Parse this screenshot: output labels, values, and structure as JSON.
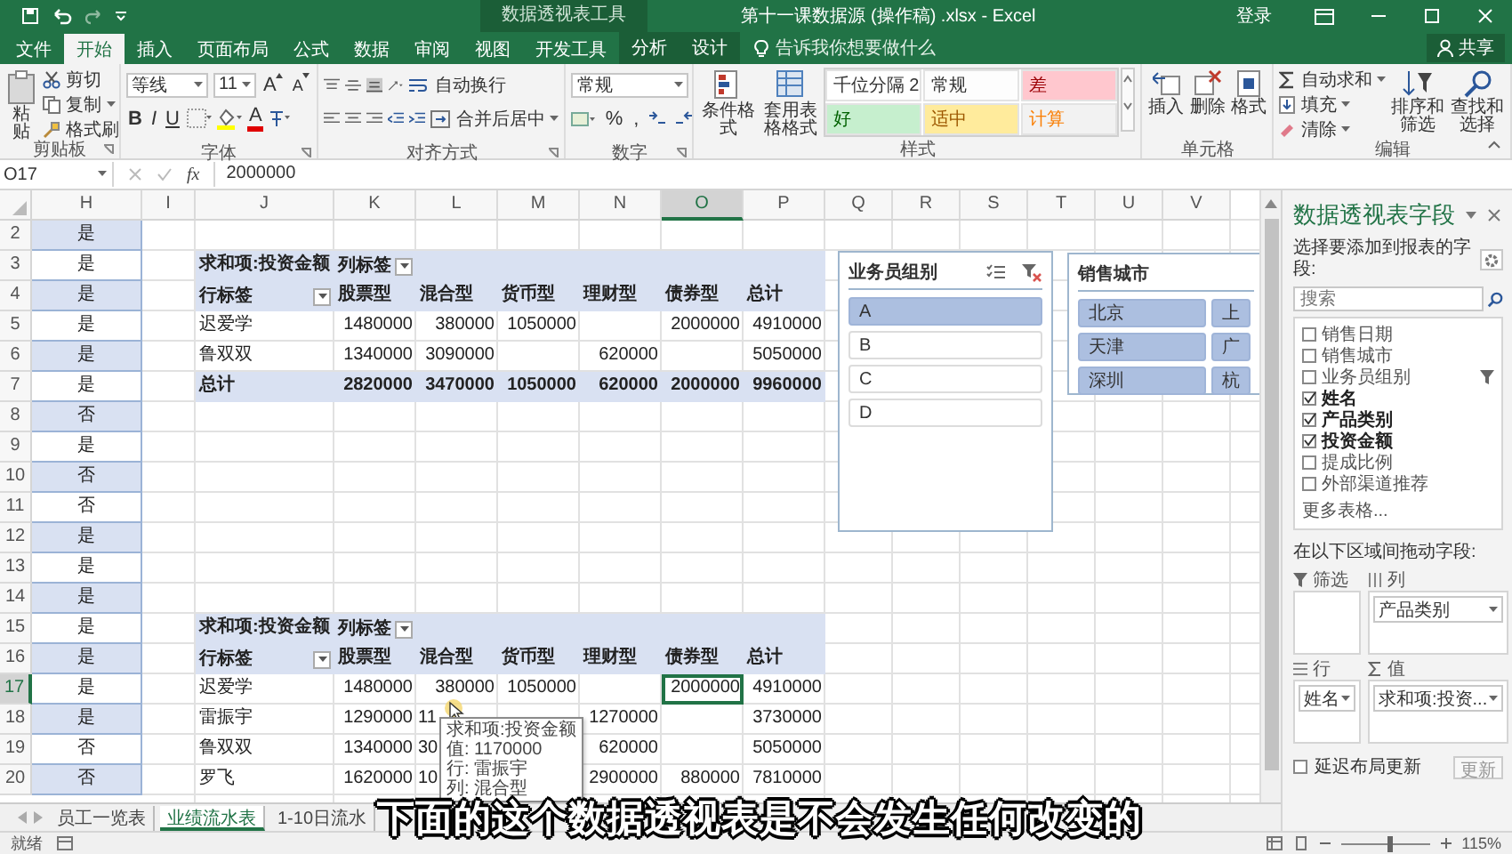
{
  "title_bar": {
    "context_label": "数据透视表工具",
    "title": "第十一课数据源 (操作稿) .xlsx - Excel",
    "sign_in": "登录"
  },
  "tabs": [
    {
      "label": "文件",
      "selected": false,
      "kind": "normal"
    },
    {
      "label": "开始",
      "selected": true,
      "kind": "normal"
    },
    {
      "label": "插入",
      "selected": false,
      "kind": "normal"
    },
    {
      "label": "页面布局",
      "selected": false,
      "kind": "normal"
    },
    {
      "label": "公式",
      "selected": false,
      "kind": "normal"
    },
    {
      "label": "数据",
      "selected": false,
      "kind": "normal"
    },
    {
      "label": "审阅",
      "selected": false,
      "kind": "normal"
    },
    {
      "label": "视图",
      "selected": false,
      "kind": "normal"
    },
    {
      "label": "开发工具",
      "selected": false,
      "kind": "normal"
    },
    {
      "label": "分析",
      "selected": false,
      "kind": "contextual"
    },
    {
      "label": "设计",
      "selected": false,
      "kind": "contextual"
    }
  ],
  "tell_me": "告诉我你想要做什么",
  "share": "共享",
  "ribbon": {
    "clipboard": {
      "paste": "粘贴",
      "cut": "剪切",
      "copy": "复制",
      "painter": "格式刷",
      "label": "剪贴板"
    },
    "font": {
      "name": "等线",
      "size": "11",
      "grow": "A",
      "shrink": "A",
      "bold": "B",
      "italic": "I",
      "underline": "U",
      "font_color": "A",
      "label": "字体"
    },
    "alignment": {
      "wrap": "自动换行",
      "merge": "合并后居中",
      "label": "对齐方式"
    },
    "number": {
      "format": "常规",
      "percent": "%",
      "comma": ",",
      "label": "数字"
    },
    "styles": {
      "conditional": "条件格式",
      "table": "套用表格格式",
      "cells": [
        {
          "label": "千位分隔 2",
          "color": "#ffffff"
        },
        {
          "label": "常规",
          "color": "#fdfdfd"
        },
        {
          "label": "差",
          "color": "#ffc7ce"
        },
        {
          "label": "好",
          "color": "#c6efce"
        },
        {
          "label": "适中",
          "color": "#ffeb9c"
        },
        {
          "label": "计算",
          "color": "#f2f2f2"
        }
      ],
      "label": "样式"
    },
    "cells": {
      "insert": "插入",
      "delete": "删除",
      "format": "格式",
      "label": "单元格"
    },
    "editing": {
      "autosum": "自动求和",
      "fill": "填充",
      "clear": "清除",
      "sort": "排序和筛选",
      "find": "查找和选择",
      "label": "编辑"
    }
  },
  "formula_bar": {
    "name_box": "O17",
    "fx": "fx",
    "value": "2000000"
  },
  "sheet": {
    "columns": [
      {
        "label": "H",
        "selected": false
      },
      {
        "label": "I",
        "selected": false
      },
      {
        "label": "J",
        "selected": false
      },
      {
        "label": "K",
        "selected": false
      },
      {
        "label": "L",
        "selected": false
      },
      {
        "label": "M",
        "selected": false
      },
      {
        "label": "N",
        "selected": false
      },
      {
        "label": "O",
        "selected": true
      },
      {
        "label": "P",
        "selected": false
      },
      {
        "label": "Q",
        "selected": false
      },
      {
        "label": "R",
        "selected": false
      },
      {
        "label": "S",
        "selected": false
      },
      {
        "label": "T",
        "selected": false
      },
      {
        "label": "U",
        "selected": false
      },
      {
        "label": "V",
        "selected": false
      }
    ],
    "rows": [
      {
        "num": "2",
        "selected": false,
        "h": "是",
        "kind": "blank"
      },
      {
        "num": "3",
        "selected": false,
        "h": "是",
        "kind": "pivot_title",
        "cells": [
          "",
          "求和项:投资金额",
          "列标签",
          "",
          "",
          "",
          "",
          ""
        ]
      },
      {
        "num": "4",
        "selected": false,
        "h": "是",
        "kind": "pivot_cols",
        "cells": [
          "",
          "行标签",
          "股票型",
          "混合型",
          "货币型",
          "理财型",
          "债券型",
          "总计"
        ]
      },
      {
        "num": "5",
        "selected": false,
        "h": "是",
        "kind": "data",
        "cells": [
          "",
          "迟爱学",
          "1480000",
          "380000",
          "1050000",
          "",
          "2000000",
          "4910000"
        ]
      },
      {
        "num": "6",
        "selected": false,
        "h": "是",
        "kind": "data",
        "cells": [
          "",
          "鲁双双",
          "1340000",
          "3090000",
          "",
          "620000",
          "",
          "5050000"
        ]
      },
      {
        "num": "7",
        "selected": false,
        "h": "是",
        "kind": "total",
        "cells": [
          "",
          "总计",
          "2820000",
          "3470000",
          "1050000",
          "620000",
          "2000000",
          "9960000"
        ]
      },
      {
        "num": "8",
        "selected": false,
        "h": "否",
        "kind": "blank"
      },
      {
        "num": "9",
        "selected": false,
        "h": "是",
        "kind": "blank"
      },
      {
        "num": "10",
        "selected": false,
        "h": "否",
        "kind": "blank"
      },
      {
        "num": "11",
        "selected": false,
        "h": "否",
        "kind": "blank"
      },
      {
        "num": "12",
        "selected": false,
        "h": "是",
        "kind": "blank"
      },
      {
        "num": "13",
        "selected": false,
        "h": "是",
        "kind": "blank"
      },
      {
        "num": "14",
        "selected": false,
        "h": "是",
        "kind": "blank"
      },
      {
        "num": "15",
        "selected": false,
        "h": "是",
        "kind": "pivot_title",
        "cells": [
          "",
          "求和项:投资金额",
          "列标签",
          "",
          "",
          "",
          "",
          ""
        ]
      },
      {
        "num": "16",
        "selected": false,
        "h": "是",
        "kind": "pivot_cols",
        "cells": [
          "",
          "行标签",
          "股票型",
          "混合型",
          "货币型",
          "理财型",
          "债券型",
          "总计"
        ]
      },
      {
        "num": "17",
        "selected": true,
        "h": "是",
        "kind": "data",
        "cells": [
          "",
          "迟爱学",
          "1480000",
          "380000",
          "1050000",
          "",
          {
            "text": "2000000",
            "selected": true
          },
          "4910000"
        ]
      },
      {
        "num": "18",
        "selected": false,
        "h": "是",
        "kind": "data",
        "cells": [
          "",
          "雷振宇",
          "1290000",
          {
            "text": "11",
            "clipped": true
          },
          "",
          "1270000",
          "",
          "3730000"
        ]
      },
      {
        "num": "19",
        "selected": false,
        "h": "否",
        "kind": "data",
        "cells": [
          "",
          "鲁双双",
          "1340000",
          {
            "text": "30",
            "clipped": true
          },
          "",
          "620000",
          "",
          "5050000"
        ]
      },
      {
        "num": "20",
        "selected": false,
        "h": "否",
        "kind": "data",
        "cells": [
          "",
          "罗飞",
          "1620000",
          {
            "text": "10",
            "clipped": true
          },
          "",
          "2900000",
          "880000",
          "7810000"
        ]
      }
    ]
  },
  "tooltip": {
    "lines": [
      "求和项:投资金额",
      "值: 1170000",
      "行: 雷振宇",
      "列: 混合型"
    ]
  },
  "slicers": [
    {
      "title": "业务员组别",
      "items": [
        {
          "label": "A",
          "selected": true
        },
        {
          "label": "B",
          "selected": false
        },
        {
          "label": "C",
          "selected": false
        },
        {
          "label": "D",
          "selected": false
        }
      ]
    },
    {
      "title": "销售城市",
      "items": [
        {
          "label": "北京",
          "selected": true
        },
        {
          "label": "上",
          "selected": true
        },
        {
          "label": "天津",
          "selected": true
        },
        {
          "label": "广",
          "selected": true
        },
        {
          "label": "深圳",
          "selected": true
        },
        {
          "label": "杭",
          "selected": true
        }
      ]
    }
  ],
  "sheet_tabs": [
    {
      "label": "员工一览表",
      "selected": false
    },
    {
      "label": "业绩流水表",
      "selected": true
    },
    {
      "label": "1-10日流水",
      "selected": false
    }
  ],
  "pivot_pane": {
    "title": "数据透视表字段",
    "subtitle": "选择要添加到报表的字段:",
    "search_placeholder": "搜索",
    "fields": [
      {
        "label": "销售日期",
        "checked": false,
        "filtered": false
      },
      {
        "label": "销售城市",
        "checked": false,
        "filtered": false
      },
      {
        "label": "业务员组别",
        "checked": false,
        "filtered": true
      },
      {
        "label": "姓名",
        "checked": true,
        "filtered": false
      },
      {
        "label": "产品类别",
        "checked": true,
        "filtered": false
      },
      {
        "label": "投资金额",
        "checked": true,
        "filtered": false
      },
      {
        "label": "提成比例",
        "checked": false,
        "filtered": false
      },
      {
        "label": "外部渠道推荐",
        "checked": false,
        "filtered": false
      }
    ],
    "more": "更多表格...",
    "drag_label": "在以下区域间拖动字段:",
    "areas": [
      {
        "title": "筛选"
      },
      {
        "title": "列",
        "fields": [
          "产品类别"
        ]
      },
      {
        "title": "行",
        "fields": [
          "姓名"
        ]
      },
      {
        "title": "值",
        "fields": [
          "求和项:投资..."
        ]
      }
    ],
    "defer": {
      "label": "延迟布局更新",
      "checked": false
    },
    "update": "更新"
  },
  "status_bar": {
    "state": "就绪",
    "zoom": {
      "label": "115%",
      "level": 0.55
    }
  },
  "caption": "下面的这个数据透视表是不会发生任何改变的"
}
